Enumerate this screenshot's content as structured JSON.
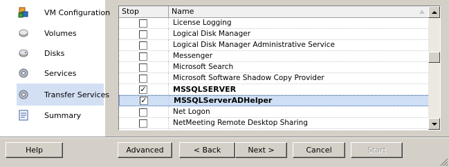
{
  "nav": {
    "items": [
      {
        "label": "VM Configuration",
        "icon": "vm-configuration-icon"
      },
      {
        "label": "Volumes",
        "icon": "volume-icon"
      },
      {
        "label": "Disks",
        "icon": "disk-icon"
      },
      {
        "label": "Services",
        "icon": "services-gear-icon"
      },
      {
        "label": "Transfer Services",
        "icon": "transfer-services-gear-icon",
        "selected": true
      },
      {
        "label": "Summary",
        "icon": "summary-document-icon"
      }
    ]
  },
  "list": {
    "columns": {
      "stop": "Stop",
      "name": "Name"
    },
    "rows": [
      {
        "name": "License Logging",
        "checked": false
      },
      {
        "name": "Logical Disk Manager",
        "checked": false
      },
      {
        "name": "Logical Disk Manager Administrative Service",
        "checked": false
      },
      {
        "name": "Messenger",
        "checked": false
      },
      {
        "name": "Microsoft Search",
        "checked": false
      },
      {
        "name": "Microsoft Software Shadow Copy Provider",
        "checked": false
      },
      {
        "name": "MSSQLSERVER",
        "checked": true,
        "bold": true
      },
      {
        "name": "MSSQLServerADHelper",
        "checked": true,
        "bold": true,
        "highlighted": true
      },
      {
        "name": "Net Logon",
        "checked": false
      },
      {
        "name": "NetMeeting Remote Desktop Sharing",
        "checked": false
      }
    ],
    "check_mark": "✓"
  },
  "buttons": {
    "help": "Help",
    "advanced": "Advanced",
    "back": "< Back",
    "next": "Next >",
    "cancel": "Cancel",
    "start": "Start"
  },
  "colors": {
    "selected_nav": "#d3e0f4",
    "highlight_row": "#cfe0f5",
    "dialog_bg": "#d4d0c8"
  }
}
